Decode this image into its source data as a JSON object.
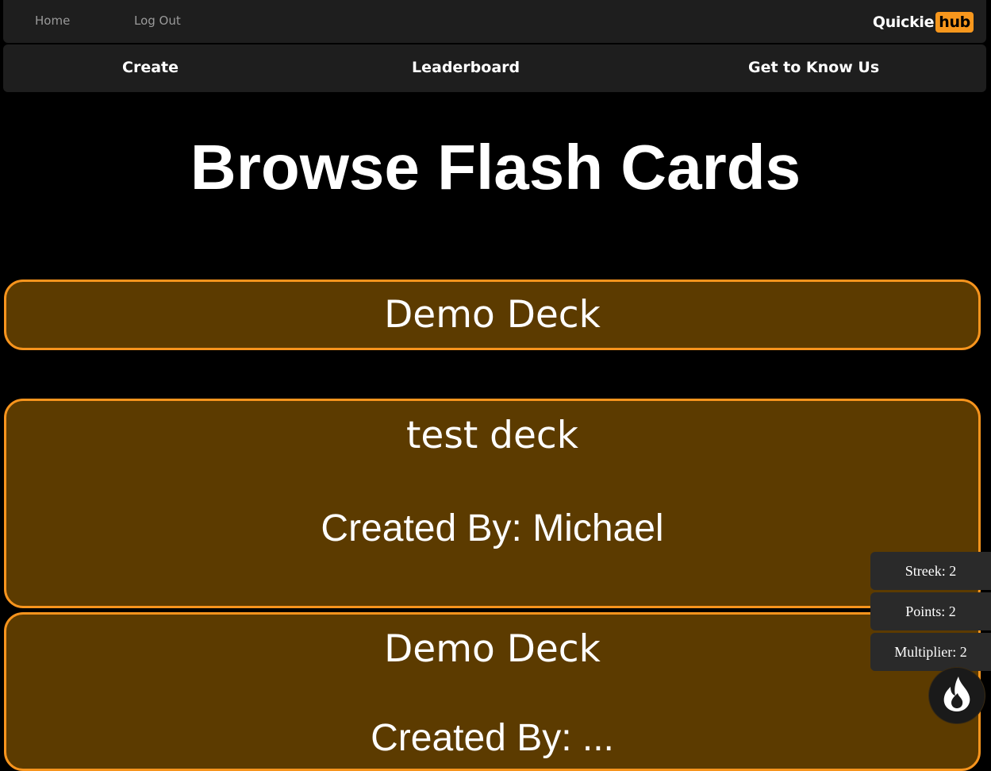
{
  "topbar": {
    "home_label": "Home",
    "logout_label": "Log Out",
    "logo_text": "Quickie",
    "logo_badge": "hub"
  },
  "nav": {
    "create_label": "Create",
    "leaderboard_label": "Leaderboard",
    "about_label": "Get to Know Us"
  },
  "page": {
    "title": "Browse Flash Cards"
  },
  "decks": [
    {
      "name": "Demo Deck"
    },
    {
      "name": "test deck",
      "author": "Created By: Michael"
    },
    {
      "name": "Demo Deck",
      "author": "Created By: ..."
    }
  ],
  "stats": {
    "streek": "Streek: 2",
    "points": "Points: 2",
    "multiplier": "Multiplier: 2"
  },
  "colors": {
    "accent": "#f7941d",
    "card_fill": "#5c3b00",
    "bar_background": "#1e1e1e",
    "page_background": "#000000"
  },
  "icons": {
    "fire_button": "fire-icon"
  }
}
